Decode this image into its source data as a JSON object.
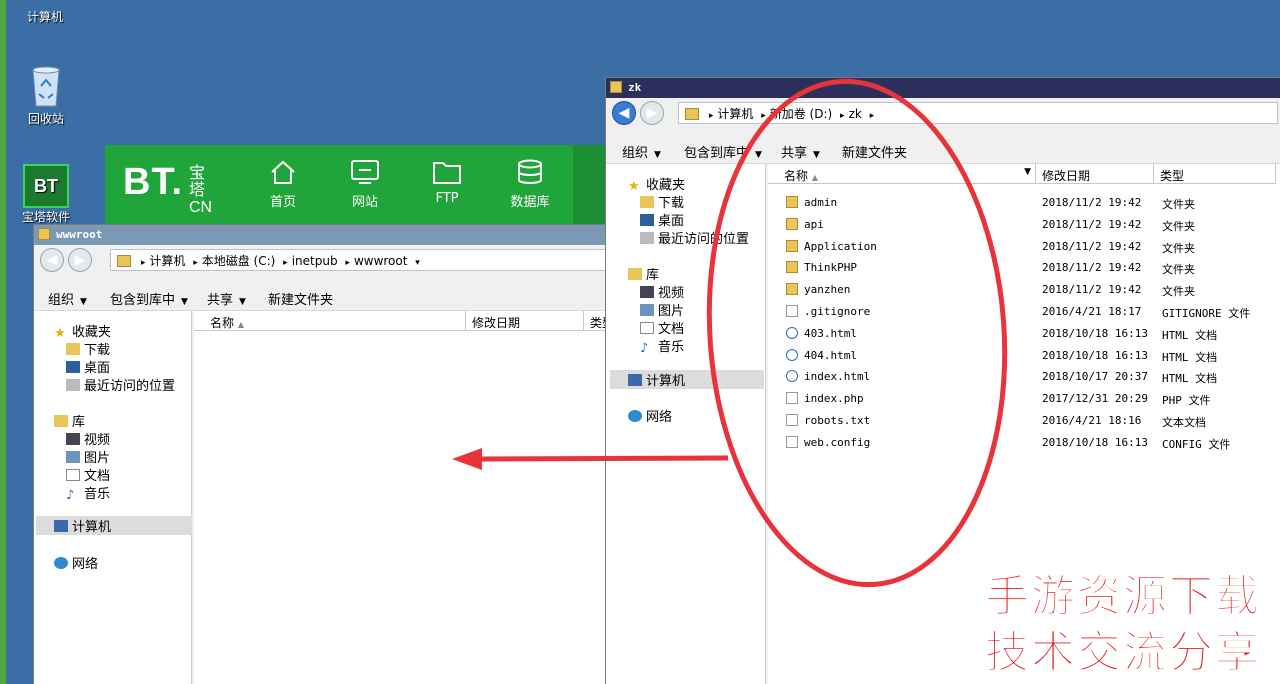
{
  "desktop": {
    "icons": [
      {
        "label": "计算机"
      },
      {
        "label": "回收站"
      },
      {
        "label": "宝塔软件"
      }
    ]
  },
  "bt_panel": {
    "logo_main": "BT.",
    "logo_cn_top": "宝塔",
    "logo_cn_bottom": "CN",
    "nav": [
      {
        "label": "首页",
        "icon": "home-icon"
      },
      {
        "label": "网站",
        "icon": "monitor-icon"
      },
      {
        "label": "FTP",
        "icon": "folder-icon"
      },
      {
        "label": "数据库",
        "icon": "database-icon"
      }
    ],
    "brand_color": "#20a53a"
  },
  "win_left": {
    "title": "wwwroot",
    "breadcrumb": [
      "计算机",
      "本地磁盘 (C:)",
      "inetpub",
      "wwwroot"
    ],
    "toolbar": {
      "organize": "组织",
      "include_library": "包含到库中",
      "share": "共享",
      "new_folder": "新建文件夹"
    },
    "sidebar": {
      "favorites": "收藏夹",
      "downloads": "下载",
      "desktop": "桌面",
      "recent": "最近访问的位置",
      "libraries": "库",
      "videos": "视频",
      "pictures": "图片",
      "documents": "文档",
      "music": "音乐",
      "computer": "计算机",
      "network": "网络"
    },
    "columns": {
      "name": "名称",
      "date": "修改日期",
      "type": "类型"
    }
  },
  "win_right": {
    "title": "zk",
    "breadcrumb": [
      "计算机",
      "新加卷 (D:)",
      "zk"
    ],
    "toolbar": {
      "organize": "组织",
      "include_library": "包含到库中",
      "share": "共享",
      "new_folder": "新建文件夹"
    },
    "sidebar": {
      "favorites": "收藏夹",
      "downloads": "下载",
      "desktop": "桌面",
      "recent": "最近访问的位置",
      "libraries": "库",
      "videos": "视频",
      "pictures": "图片",
      "documents": "文档",
      "music": "音乐",
      "computer": "计算机",
      "network": "网络"
    },
    "columns": {
      "name": "名称",
      "date": "修改日期",
      "type": "类型"
    },
    "files": [
      {
        "name": "admin",
        "date": "2018/11/2 19:42",
        "type": "文件夹",
        "kind": "folder"
      },
      {
        "name": "api",
        "date": "2018/11/2 19:42",
        "type": "文件夹",
        "kind": "folder"
      },
      {
        "name": "Application",
        "date": "2018/11/2 19:42",
        "type": "文件夹",
        "kind": "folder"
      },
      {
        "name": "ThinkPHP",
        "date": "2018/11/2 19:42",
        "type": "文件夹",
        "kind": "folder"
      },
      {
        "name": "yanzhen",
        "date": "2018/11/2 19:42",
        "type": "文件夹",
        "kind": "folder"
      },
      {
        "name": ".gitignore",
        "date": "2016/4/21 18:17",
        "type": "GITIGNORE 文件",
        "kind": "file"
      },
      {
        "name": "403.html",
        "date": "2018/10/18 16:13",
        "type": "HTML 文档",
        "kind": "html"
      },
      {
        "name": "404.html",
        "date": "2018/10/18 16:13",
        "type": "HTML 文档",
        "kind": "html"
      },
      {
        "name": "index.html",
        "date": "2018/10/17 20:37",
        "type": "HTML 文档",
        "kind": "html"
      },
      {
        "name": "index.php",
        "date": "2017/12/31 20:29",
        "type": "PHP 文件",
        "kind": "file"
      },
      {
        "name": "robots.txt",
        "date": "2016/4/21 18:16",
        "type": "文本文档",
        "kind": "file"
      },
      {
        "name": "web.config",
        "date": "2018/10/18 16:13",
        "type": "CONFIG 文件",
        "kind": "file"
      }
    ]
  },
  "watermark": {
    "line1": "手游资源下载",
    "line2": "技术交流分享"
  },
  "annotation_color": "#e8333a"
}
